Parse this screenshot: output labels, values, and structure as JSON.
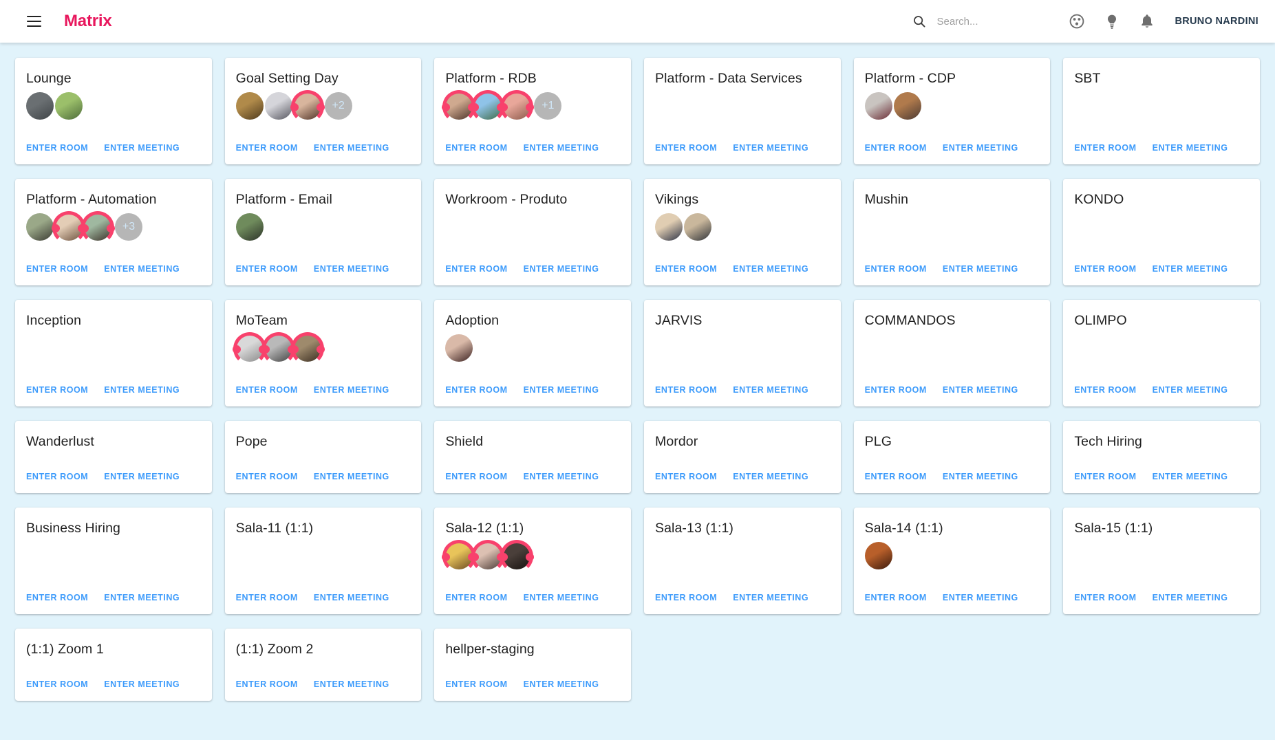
{
  "app": {
    "brand": "Matrix",
    "accent_color": "#e8175d",
    "link_color": "#3d9bfb",
    "background_color": "#e1f3fb",
    "card_color": "#ffffff",
    "oncall_ring_color": "#f8416c"
  },
  "header": {
    "menu_icon": "hamburger-menu-icon",
    "search_icon": "search-icon",
    "search_placeholder": "Search...",
    "search_value": "",
    "icons": [
      {
        "name": "people-group-icon",
        "glyph": "group"
      },
      {
        "name": "lightbulb-icon",
        "glyph": "bulb"
      },
      {
        "name": "notifications-bell-icon",
        "glyph": "bell"
      }
    ],
    "user_name": "BRUNO NARDINI"
  },
  "actions": {
    "enter_room": "ENTER ROOM",
    "enter_meeting": "ENTER MEETING"
  },
  "rooms": [
    {
      "title": "Lounge",
      "size": "tall",
      "avatars": [
        {
          "oncall": false,
          "bg": "#6a6f72,#3f4447"
        },
        {
          "oncall": false,
          "bg": "#9bbf6a,#4d6b3a"
        }
      ],
      "overflow": null
    },
    {
      "title": "Goal Setting Day",
      "size": "tall",
      "avatars": [
        {
          "oncall": false,
          "bg": "#b08a4a,#4e3a1c"
        },
        {
          "oncall": false,
          "bg": "#d5d5da,#55555e"
        },
        {
          "oncall": true,
          "bg": "#d8b59d,#4e3226"
        }
      ],
      "overflow": "+2"
    },
    {
      "title": "Platform - RDB",
      "size": "tall",
      "avatars": [
        {
          "oncall": true,
          "bg": "#cfa98f,#4b3328"
        },
        {
          "oncall": true,
          "bg": "#8fc3e8,#3f6b46"
        },
        {
          "oncall": true,
          "bg": "#e8a79a,#8b5a4b"
        }
      ],
      "overflow": "+1"
    },
    {
      "title": "Platform - Data Services",
      "size": "tall",
      "avatars": [],
      "overflow": null
    },
    {
      "title": "Platform - CDP",
      "size": "tall",
      "avatars": [
        {
          "oncall": false,
          "bg": "#c9c4c0,#6a2b34"
        },
        {
          "oncall": false,
          "bg": "#b07a4c,#4b3a33"
        }
      ],
      "overflow": null
    },
    {
      "title": "SBT",
      "size": "tall",
      "avatars": [],
      "overflow": null
    },
    {
      "title": "Platform - Automation",
      "size": "tall",
      "avatars": [
        {
          "oncall": false,
          "bg": "#9aa888,#3a3a32"
        },
        {
          "oncall": true,
          "bg": "#e3cdb6,#6d523f"
        },
        {
          "oncall": true,
          "bg": "#9fb8a0,#3b3028"
        }
      ],
      "overflow": "+3"
    },
    {
      "title": "Platform - Email",
      "size": "tall",
      "avatars": [
        {
          "oncall": false,
          "bg": "#6f8b5c,#2c3228"
        }
      ],
      "overflow": null
    },
    {
      "title": "Workroom - Produto",
      "size": "tall",
      "avatars": [],
      "overflow": null
    },
    {
      "title": "Vikings",
      "size": "tall",
      "avatars": [
        {
          "oncall": false,
          "bg": "#e0cdb2,#2c3245"
        },
        {
          "oncall": false,
          "bg": "#c9b79c,#2f3338"
        }
      ],
      "overflow": null
    },
    {
      "title": "Mushin",
      "size": "tall",
      "avatars": [],
      "overflow": null
    },
    {
      "title": "KONDO",
      "size": "tall",
      "avatars": [],
      "overflow": null
    },
    {
      "title": "Inception",
      "size": "tall",
      "avatars": [],
      "overflow": null
    },
    {
      "title": "MoTeam",
      "size": "tall",
      "avatars": [
        {
          "oncall": true,
          "bg": "#d9d9d9,#8a8a8a"
        },
        {
          "oncall": true,
          "bg": "#b9b9b9,#434343"
        },
        {
          "oncall": true,
          "bg": "#9e8a6c,#3a2d21"
        }
      ],
      "overflow": null
    },
    {
      "title": "Adoption",
      "size": "tall",
      "avatars": [
        {
          "oncall": false,
          "bg": "#d9b9a8,#3a2020"
        }
      ],
      "overflow": null
    },
    {
      "title": "JARVIS",
      "size": "tall",
      "avatars": [],
      "overflow": null
    },
    {
      "title": "COMMANDOS",
      "size": "tall",
      "avatars": [],
      "overflow": null
    },
    {
      "title": "OLIMPO",
      "size": "tall",
      "avatars": [],
      "overflow": null
    },
    {
      "title": "Wanderlust",
      "size": "short",
      "avatars": [],
      "overflow": null
    },
    {
      "title": "Pope",
      "size": "short",
      "avatars": [],
      "overflow": null
    },
    {
      "title": "Shield",
      "size": "short",
      "avatars": [],
      "overflow": null
    },
    {
      "title": "Mordor",
      "size": "short",
      "avatars": [],
      "overflow": null
    },
    {
      "title": "PLG",
      "size": "short",
      "avatars": [],
      "overflow": null
    },
    {
      "title": "Tech Hiring",
      "size": "short",
      "avatars": [],
      "overflow": null
    },
    {
      "title": "Business Hiring",
      "size": "tall",
      "avatars": [],
      "overflow": null
    },
    {
      "title": "Sala-11 (1:1)",
      "size": "tall",
      "avatars": [],
      "overflow": null
    },
    {
      "title": "Sala-12 (1:1)",
      "size": "tall",
      "avatars": [
        {
          "oncall": true,
          "bg": "#e8c45a,#6b4a22"
        },
        {
          "oncall": true,
          "bg": "#dcc0b2,#4a3b36"
        },
        {
          "oncall": true,
          "bg": "#4a3f3a,#17120f"
        }
      ],
      "overflow": null
    },
    {
      "title": "Sala-13 (1:1)",
      "size": "tall",
      "avatars": [],
      "overflow": null
    },
    {
      "title": "Sala-14 (1:1)",
      "size": "tall",
      "avatars": [
        {
          "oncall": false,
          "bg": "#b85f2a,#3a1a0d"
        }
      ],
      "overflow": null
    },
    {
      "title": "Sala-15 (1:1)",
      "size": "tall",
      "avatars": [],
      "overflow": null
    },
    {
      "title": "(1:1) Zoom 1",
      "size": "short",
      "avatars": [],
      "overflow": null
    },
    {
      "title": "(1:1) Zoom 2",
      "size": "short",
      "avatars": [],
      "overflow": null
    },
    {
      "title": "hellper-staging",
      "size": "short",
      "avatars": [],
      "overflow": null
    }
  ]
}
